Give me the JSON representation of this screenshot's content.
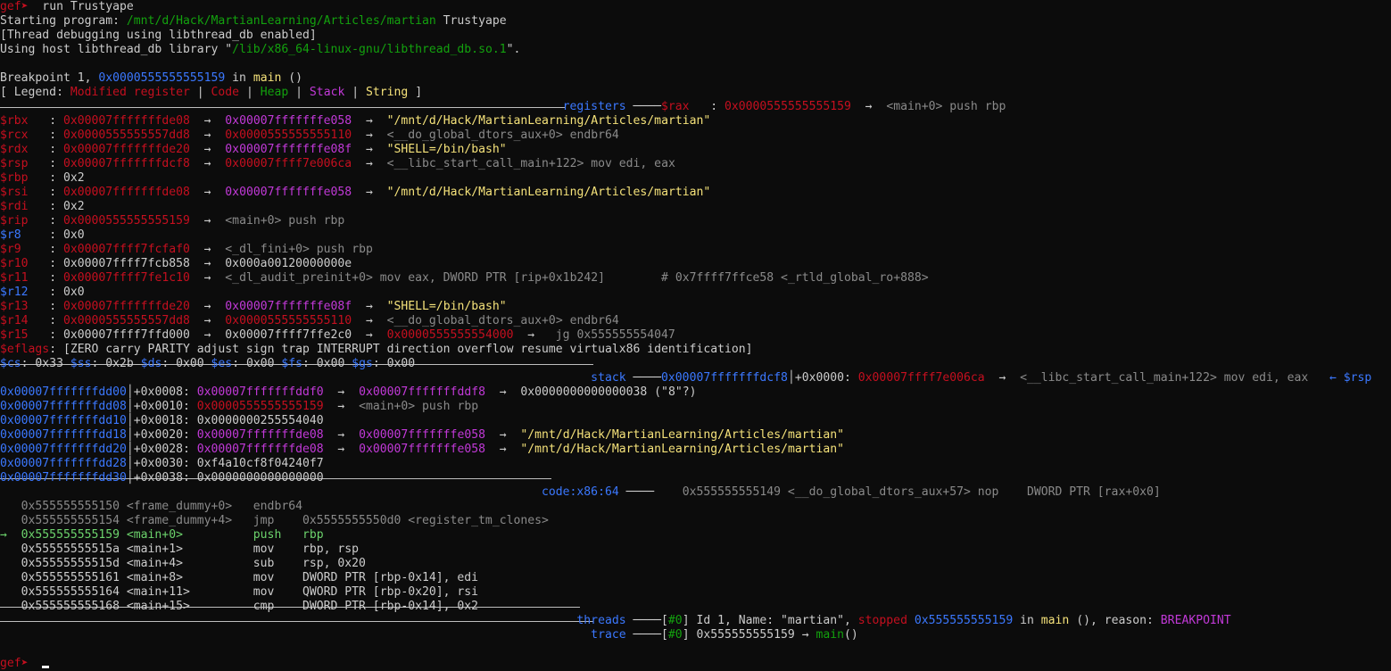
{
  "colors": {
    "default": "#cccccc",
    "red": "#c50f1f",
    "magenta": "#c239d8",
    "yellow": "#f5e27a",
    "gray": "#8a8a8a",
    "blue": "#3b78ff",
    "green": "#13a10e",
    "bright_green": "#6cd36c",
    "white": "#f2f2f2"
  },
  "lines": [
    [
      [
        "gef➤ ",
        "red"
      ],
      [
        " run Trustyape",
        "default"
      ]
    ],
    [
      [
        "Starting program: ",
        "default"
      ],
      [
        "/mnt/d/Hack/MartianLearning/Articles/martian",
        "green"
      ],
      [
        " Trustyape",
        "default"
      ]
    ],
    [
      [
        "[Thread debugging using libthread_db enabled]",
        "default"
      ]
    ],
    [
      [
        "Using host libthread_db library \"",
        "default"
      ],
      [
        "/lib/x86_64-linux-gnu/libthread_db.so.1",
        "green"
      ],
      [
        "\".",
        "default"
      ]
    ],
    [
      [
        "",
        "default"
      ]
    ],
    [
      [
        "Breakpoint 1, ",
        "default"
      ],
      [
        "0x0000555555555159",
        "blue"
      ],
      [
        " in ",
        "default"
      ],
      [
        "main",
        "yellow"
      ],
      [
        " ()",
        "default"
      ]
    ],
    [
      [
        "[ Legend: ",
        "default"
      ],
      [
        "Modified register",
        "red"
      ],
      [
        " | ",
        "default"
      ],
      [
        "Code",
        "red"
      ],
      [
        " | ",
        "default"
      ],
      [
        "Heap",
        "green"
      ],
      [
        " | ",
        "default"
      ],
      [
        "Stack",
        "magenta"
      ],
      [
        " | ",
        "default"
      ],
      [
        "String",
        "yellow"
      ],
      [
        " ]",
        "default"
      ]
    ],
    [
      [
        "                                                                                registers ",
        "blue"
      ],
      [
        "────",
        "default"
      ],
      [
        "$rax   ",
        "red"
      ],
      [
        ": ",
        "default"
      ],
      [
        "0x0000555555555159",
        "red"
      ],
      [
        "  →  ",
        "default"
      ],
      [
        "<main+0> push rbp",
        "gray"
      ]
    ],
    [
      [
        "$rbx   ",
        "red"
      ],
      [
        ": ",
        "default"
      ],
      [
        "0x00007fffffffde08",
        "red"
      ],
      [
        "  →  ",
        "default"
      ],
      [
        "0x00007fffffffe058",
        "magenta"
      ],
      [
        "  →  ",
        "default"
      ],
      [
        "\"/mnt/d/Hack/MartianLearning/Articles/martian\"",
        "yellow"
      ]
    ],
    [
      [
        "$rcx   ",
        "red"
      ],
      [
        ": ",
        "default"
      ],
      [
        "0x0000555555557dd8",
        "red"
      ],
      [
        "  →  ",
        "default"
      ],
      [
        "0x0000555555555110",
        "red"
      ],
      [
        "  →  ",
        "default"
      ],
      [
        "<__do_global_dtors_aux+0> endbr64",
        "gray"
      ]
    ],
    [
      [
        "$rdx   ",
        "red"
      ],
      [
        ": ",
        "default"
      ],
      [
        "0x00007fffffffde20",
        "red"
      ],
      [
        "  →  ",
        "default"
      ],
      [
        "0x00007fffffffe08f",
        "magenta"
      ],
      [
        "  →  ",
        "default"
      ],
      [
        "\"SHELL=/bin/bash\"",
        "yellow"
      ]
    ],
    [
      [
        "$rsp   ",
        "red"
      ],
      [
        ": ",
        "default"
      ],
      [
        "0x00007fffffffdcf8",
        "red"
      ],
      [
        "  →  ",
        "default"
      ],
      [
        "0x00007ffff7e006ca",
        "red"
      ],
      [
        "  →  ",
        "default"
      ],
      [
        "<__libc_start_call_main+122> mov edi, eax",
        "gray"
      ]
    ],
    [
      [
        "$rbp   ",
        "red"
      ],
      [
        ": 0x2",
        "default"
      ]
    ],
    [
      [
        "$rsi   ",
        "red"
      ],
      [
        ": ",
        "default"
      ],
      [
        "0x00007fffffffde08",
        "red"
      ],
      [
        "  →  ",
        "default"
      ],
      [
        "0x00007fffffffe058",
        "magenta"
      ],
      [
        "  →  ",
        "default"
      ],
      [
        "\"/mnt/d/Hack/MartianLearning/Articles/martian\"",
        "yellow"
      ]
    ],
    [
      [
        "$rdi   ",
        "red"
      ],
      [
        ": 0x2",
        "default"
      ]
    ],
    [
      [
        "$rip   ",
        "red"
      ],
      [
        ": ",
        "default"
      ],
      [
        "0x0000555555555159",
        "red"
      ],
      [
        "  →  ",
        "default"
      ],
      [
        "<main+0> push rbp",
        "gray"
      ]
    ],
    [
      [
        "$r8    ",
        "blue"
      ],
      [
        ": 0x0",
        "default"
      ]
    ],
    [
      [
        "$r9    ",
        "red"
      ],
      [
        ": ",
        "default"
      ],
      [
        "0x00007ffff7fcfaf0",
        "red"
      ],
      [
        "  →  ",
        "default"
      ],
      [
        "<_dl_fini+0> push rbp",
        "gray"
      ]
    ],
    [
      [
        "$r10   ",
        "red"
      ],
      [
        ": 0x00007ffff7fcb858  →  0x000a00120000000e",
        "default"
      ]
    ],
    [
      [
        "$r11   ",
        "red"
      ],
      [
        ": ",
        "default"
      ],
      [
        "0x00007ffff7fe1c10",
        "red"
      ],
      [
        "  →  ",
        "default"
      ],
      [
        "<_dl_audit_preinit+0> mov eax, DWORD PTR [rip+0x1b242]        # 0x7ffff7ffce58 <_rtld_global_ro+888>",
        "gray"
      ]
    ],
    [
      [
        "$r12   ",
        "blue"
      ],
      [
        ": 0x0",
        "default"
      ]
    ],
    [
      [
        "$r13   ",
        "red"
      ],
      [
        ": ",
        "default"
      ],
      [
        "0x00007fffffffde20",
        "red"
      ],
      [
        "  →  ",
        "default"
      ],
      [
        "0x00007fffffffe08f",
        "magenta"
      ],
      [
        "  →  ",
        "default"
      ],
      [
        "\"SHELL=/bin/bash\"",
        "yellow"
      ]
    ],
    [
      [
        "$r14   ",
        "red"
      ],
      [
        ": ",
        "default"
      ],
      [
        "0x0000555555557dd8",
        "red"
      ],
      [
        "  →  ",
        "default"
      ],
      [
        "0x0000555555555110",
        "red"
      ],
      [
        "  →  ",
        "default"
      ],
      [
        "<__do_global_dtors_aux+0> endbr64",
        "gray"
      ]
    ],
    [
      [
        "$r15   ",
        "red"
      ],
      [
        ": 0x00007ffff7ffd000  →  0x00007ffff7ffe2c0  →  ",
        "default"
      ],
      [
        "0x0000555555554000",
        "red"
      ],
      [
        "  →  ",
        "default"
      ],
      [
        " jg 0x555555554047",
        "gray"
      ]
    ],
    [
      [
        "$eflags",
        "red"
      ],
      [
        ": [ZERO carry PARITY adjust sign trap INTERRUPT direction overflow resume virtualx86 identification]",
        "default"
      ]
    ],
    [
      [
        "$cs",
        "blue"
      ],
      [
        ": 0x33 ",
        "default"
      ],
      [
        "$ss",
        "blue"
      ],
      [
        ": 0x2b ",
        "default"
      ],
      [
        "$ds",
        "blue"
      ],
      [
        ": 0x00 ",
        "default"
      ],
      [
        "$es",
        "blue"
      ],
      [
        ": 0x00 ",
        "default"
      ],
      [
        "$fs",
        "blue"
      ],
      [
        ": 0x00 ",
        "default"
      ],
      [
        "$gs",
        "blue"
      ],
      [
        ": 0x00",
        "default"
      ]
    ],
    [
      [
        "                                                                                    stack ",
        "blue"
      ],
      [
        "────",
        "default"
      ],
      [
        "0x00007fffffffdcf8",
        "blue"
      ],
      [
        "│+0x0000: ",
        "default"
      ],
      [
        "0x00007ffff7e006ca",
        "red"
      ],
      [
        "  →  ",
        "default"
      ],
      [
        "<__libc_start_call_main+122> mov edi, eax",
        "gray"
      ],
      [
        "   ← $rsp",
        "blue"
      ]
    ],
    [
      [
        "0x00007fffffffdd00",
        "blue"
      ],
      [
        "│+0x0008: ",
        "default"
      ],
      [
        "0x00007fffffffddf0",
        "magenta"
      ],
      [
        "  →  ",
        "default"
      ],
      [
        "0x00007fffffffddf8",
        "magenta"
      ],
      [
        "  →  0x0000000000000038 (\"8\"?)",
        "default"
      ]
    ],
    [
      [
        "0x00007fffffffdd08",
        "blue"
      ],
      [
        "│+0x0010: ",
        "default"
      ],
      [
        "0x0000555555555159",
        "red"
      ],
      [
        "  →  ",
        "default"
      ],
      [
        "<main+0> push rbp",
        "gray"
      ]
    ],
    [
      [
        "0x00007fffffffdd10",
        "blue"
      ],
      [
        "│+0x0018: 0x0000000255554040",
        "default"
      ]
    ],
    [
      [
        "0x00007fffffffdd18",
        "blue"
      ],
      [
        "│+0x0020: ",
        "default"
      ],
      [
        "0x00007fffffffde08",
        "magenta"
      ],
      [
        "  →  ",
        "default"
      ],
      [
        "0x00007fffffffe058",
        "magenta"
      ],
      [
        "  →  ",
        "default"
      ],
      [
        "\"/mnt/d/Hack/MartianLearning/Articles/martian\"",
        "yellow"
      ]
    ],
    [
      [
        "0x00007fffffffdd20",
        "blue"
      ],
      [
        "│+0x0028: ",
        "default"
      ],
      [
        "0x00007fffffffde08",
        "magenta"
      ],
      [
        "  →  ",
        "default"
      ],
      [
        "0x00007fffffffe058",
        "magenta"
      ],
      [
        "  →  ",
        "default"
      ],
      [
        "\"/mnt/d/Hack/MartianLearning/Articles/martian\"",
        "yellow"
      ]
    ],
    [
      [
        "0x00007fffffffdd28",
        "blue"
      ],
      [
        "│+0x0030: 0xf4a10cf8f04240f7",
        "default"
      ]
    ],
    [
      [
        "0x00007fffffffdd30",
        "blue"
      ],
      [
        "│+0x0038: 0x0000000000000000",
        "default"
      ]
    ],
    [
      [
        "                                                                             code:x86:64 ",
        "blue"
      ],
      [
        "────    ",
        "default"
      ],
      [
        "0x555555555149 <__do_global_dtors_aux+57> nop    DWORD PTR [rax+0x0]",
        "gray"
      ]
    ],
    [
      [
        "   0x555555555150 <frame_dummy+0>   endbr64",
        "gray"
      ]
    ],
    [
      [
        "   0x555555555154 <frame_dummy+4>   jmp    0x5555555550d0 <register_tm_clones>",
        "gray"
      ]
    ],
    [
      [
        "→  0x555555555159 <main+0>          push   rbp",
        "bright_green"
      ]
    ],
    [
      [
        "   0x55555555515a <main+1>          mov    rbp, rsp",
        "default"
      ]
    ],
    [
      [
        "   0x55555555515d <main+4>          sub    rsp, 0x20",
        "default"
      ]
    ],
    [
      [
        "   0x555555555161 <main+8>          mov    DWORD PTR [rbp-0x14], edi",
        "default"
      ]
    ],
    [
      [
        "   0x555555555164 <main+11>         mov    QWORD PTR [rbp-0x20], rsi",
        "default"
      ]
    ],
    [
      [
        "   0x555555555168 <main+15>         cmp    DWORD PTR [rbp-0x14], 0x2",
        "default"
      ]
    ],
    [
      [
        "                                                                                  threads ",
        "blue"
      ],
      [
        "────[",
        "default"
      ],
      [
        "#0",
        "green"
      ],
      [
        "] Id 1, Name: \"martian\", ",
        "default"
      ],
      [
        "stopped",
        "red"
      ],
      [
        " ",
        "default"
      ],
      [
        "0x555555555159",
        "blue"
      ],
      [
        " in ",
        "default"
      ],
      [
        "main",
        "yellow"
      ],
      [
        " (), reason: ",
        "default"
      ],
      [
        "BREAKPOINT",
        "magenta"
      ]
    ],
    [
      [
        "                                                                                    trace ",
        "blue"
      ],
      [
        "────[",
        "default"
      ],
      [
        "#0",
        "green"
      ],
      [
        "] 0x555555555159 → ",
        "default"
      ],
      [
        "main",
        "green"
      ],
      [
        "()",
        "default"
      ]
    ],
    [
      [
        "",
        "default"
      ]
    ],
    [
      [
        "gef➤ ",
        "red"
      ],
      [
        " ",
        "default"
      ]
    ]
  ]
}
